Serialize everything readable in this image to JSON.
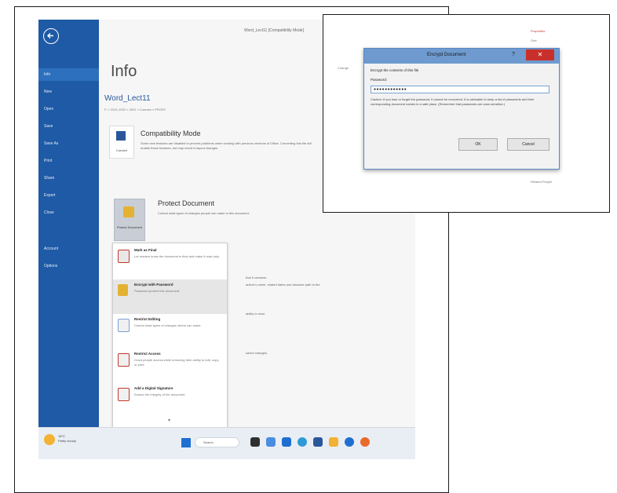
{
  "window": {
    "doc_title": "Word_Lect11 [Compatibility Mode]"
  },
  "sidebar": {
    "items": [
      {
        "label": "Info"
      },
      {
        "label": "New"
      },
      {
        "label": "Open"
      },
      {
        "label": "Save"
      },
      {
        "label": "Save As"
      },
      {
        "label": "Print"
      },
      {
        "label": "Share"
      },
      {
        "label": "Export"
      },
      {
        "label": "Close"
      },
      {
        "label": "Account"
      },
      {
        "label": "Options"
      }
    ]
  },
  "main": {
    "page_title": "Info",
    "doc_name": "Word_Lect11",
    "doc_path": "F: » 2021-2022 » 2021 » Courses » PROF6",
    "compat": {
      "button_label": "Convert",
      "title": "Compatibility Mode",
      "desc": "Some new features are disabled to prevent problems when working with previous versions of Office. Converting this file will enable these features, but may result in layout changes."
    },
    "protect": {
      "button_label": "Protect Document",
      "title": "Protect Document",
      "desc": "Control what types of changes people can make to this document."
    },
    "dropdown": [
      {
        "title": "Mark as Final",
        "desc": "Let readers know the document is final and make it read-only."
      },
      {
        "title": "Encrypt with Password",
        "desc": "Password-protect this document."
      },
      {
        "title": "Restrict Editing",
        "desc": "Control what types of changes others can make."
      },
      {
        "title": "Restrict Access",
        "desc": "Grant people access while removing their ability to edit, copy, or print."
      },
      {
        "title": "Add a Digital Signature",
        "desc": "Ensure the integrity of the document."
      }
    ],
    "right_texts": {
      "inspect": "that it contains:",
      "inspect_desc": "author's name, related dates and absolute path to the",
      "accessibility": "ability to read",
      "versions": "saved changes."
    }
  },
  "taskbar": {
    "weather_temp": "18°C",
    "weather_desc": "Partly cloudy",
    "search_label": "Search"
  },
  "popup": {
    "bg_texts": {
      "properties": "Properties",
      "size": "Size",
      "change": "Change",
      "related": "Related People"
    },
    "dialog": {
      "title": "Encrypt Document",
      "help": "?",
      "close": "✕",
      "heading": "Encrypt the contents of this file",
      "password_label": "Password:",
      "password_value": "●●●●●●●●●●●●",
      "caution": "Caution: If you lose or forget the password, it cannot be recovered. It is advisable to keep a list of passwords and their corresponding document names in a safe place. (Remember that passwords are case-sensitive.)",
      "ok_label": "OK",
      "cancel_label": "Cancel"
    }
  },
  "colors": {
    "sidebar": "#1e5aa5",
    "accent": "#2b579a",
    "dialog_title": "#6e9acf",
    "close": "#c9302c"
  }
}
